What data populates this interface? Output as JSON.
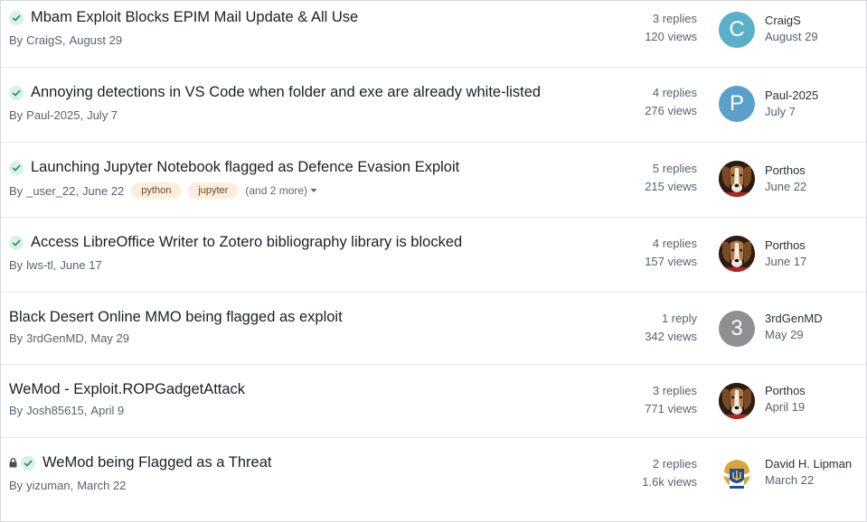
{
  "topics": [
    {
      "title": "Mbam Exploit Blocks EPIM Mail Update & All Use",
      "solved": true,
      "locked": false,
      "by": "By",
      "author": "CraigS",
      "date": "August 29",
      "tags": [],
      "more": "",
      "replies": "3 replies",
      "views": "120 views",
      "last_user": "CraigS",
      "last_date": "August 29",
      "avatar_letter": "C",
      "avatar_color": "#5aafc9",
      "avatar_kind": "letter"
    },
    {
      "title": "Annoying detections in VS Code when folder and exe are already white-listed",
      "solved": true,
      "locked": false,
      "by": "By",
      "author": "Paul-2025",
      "date": "July 7",
      "tags": [],
      "more": "",
      "replies": "4 replies",
      "views": "276 views",
      "last_user": "Paul-2025",
      "last_date": "July 7",
      "avatar_letter": "P",
      "avatar_color": "#5aa0c9",
      "avatar_kind": "letter"
    },
    {
      "title": "Launching Jupyter Notebook flagged as Defence Evasion Exploit",
      "solved": true,
      "locked": false,
      "by": "By",
      "author": "_user_22",
      "date": "June 22",
      "tags": [
        "python",
        "jupyter"
      ],
      "more": "(and 2 more)",
      "replies": "5 replies",
      "views": "215 views",
      "last_user": "Porthos",
      "last_date": "June 22",
      "avatar_letter": "",
      "avatar_color": "#3a2a20",
      "avatar_kind": "dog"
    },
    {
      "title": "Access LibreOffice Writer to Zotero bibliography library is blocked",
      "solved": true,
      "locked": false,
      "by": "By",
      "author": "lws-tl",
      "date": "June 17",
      "tags": [],
      "more": "",
      "replies": "4 replies",
      "views": "157 views",
      "last_user": "Porthos",
      "last_date": "June 17",
      "avatar_letter": "",
      "avatar_color": "#3a2a20",
      "avatar_kind": "dog"
    },
    {
      "title": "Black Desert Online MMO being flagged as exploit",
      "solved": false,
      "locked": false,
      "by": "By",
      "author": "3rdGenMD",
      "date": "May 29",
      "tags": [],
      "more": "",
      "replies": "1 reply",
      "views": "342 views",
      "last_user": "3rdGenMD",
      "last_date": "May 29",
      "avatar_letter": "3",
      "avatar_color": "#8f8f91",
      "avatar_kind": "letter"
    },
    {
      "title": "WeMod - Exploit.ROPGadgetAttack",
      "solved": false,
      "locked": false,
      "by": "By",
      "author": "Josh85615",
      "date": "April 9",
      "tags": [],
      "more": "",
      "replies": "3 replies",
      "views": "771 views",
      "last_user": "Porthos",
      "last_date": "April 19",
      "avatar_letter": "",
      "avatar_color": "#3a2a20",
      "avatar_kind": "dog"
    },
    {
      "title": "WeMod being Flagged as a Threat",
      "solved": true,
      "locked": true,
      "by": "By",
      "author": "yizuman",
      "date": "March 22",
      "tags": [],
      "more": "",
      "replies": "2 replies",
      "views": "1.6k views",
      "last_user": "David H. Lipman",
      "last_date": "March 22",
      "avatar_letter": "",
      "avatar_color": "#1f3f8f",
      "avatar_kind": "crest"
    }
  ],
  "colors": {
    "check_bg": "#d9f1e7",
    "check_mark": "#1f8a5b",
    "tag_bg": "#fbeedd"
  }
}
